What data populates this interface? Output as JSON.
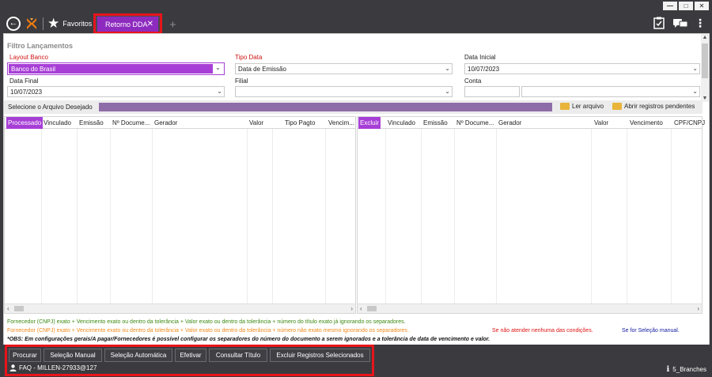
{
  "titlebar": {
    "window_controls": [
      "—",
      "□",
      "✕"
    ],
    "favorites_label": "Favoritos",
    "active_tab": "Retorno DDA",
    "tab_close": "✕",
    "tab_add": "+"
  },
  "filters": {
    "section_title": "Filtro Lançamentos",
    "layout_banco": {
      "label": "Layout Banco",
      "value": "Banco do Brasil"
    },
    "tipo_data": {
      "label": "Tipo Data",
      "value": "Data de Emissão"
    },
    "data_inicial": {
      "label": "Data Inicial",
      "value": "10/07/2023"
    },
    "data_final": {
      "label": "Data Final",
      "value": "10/07/2023"
    },
    "filial": {
      "label": "Filial",
      "value": ""
    },
    "conta": {
      "label": "Conta",
      "value": ""
    }
  },
  "file_selector": {
    "label": "Selecione o Arquivo Desejado",
    "read_file": "Ler arquivo",
    "open_pending": "Abrir registros pendentes"
  },
  "left_grid": {
    "columns": [
      "Processado",
      "Vinculado",
      "Emissão",
      "Nº Documento",
      "Gerador",
      "Valor",
      "Tipo Pagto",
      "Vencim..."
    ],
    "columns_display": [
      "Processado",
      "Vinculado",
      "Emissão",
      "Nº Docume...",
      "Gerador",
      "Valor",
      "Tipo Pagto",
      "Vencim..."
    ]
  },
  "right_grid": {
    "columns_display": [
      "Excluir",
      "Vinculado",
      "Emissão",
      "Nº Docume...",
      "Gerador",
      "Valor",
      "Vencimento",
      "CPF/CNPJ"
    ]
  },
  "legend": {
    "green": "Fornecedor (CNPJ) exato + Vencimento exato ou dentro da tolerância + Valor exato ou dentro da tolerância + número do título exato já ignorando os separadores.",
    "orange": "Fornecedor (CNPJ) exato + Vencimento exato ou dentro da tolerância + Valor exato ou dentro da tolerância + número não exato mesmo ignorando os separadores .",
    "red": "Se não atender nenhuma das condições.",
    "blue": "Se for Seleção manual.",
    "obs": "*OBS: Em configurações gerais/A pagar/Fornecedores é possível configurar os separadores do número do documento a serem ignorados e a tolerância de data de vencimento e valor."
  },
  "actions": {
    "procurar": "Procurar",
    "selecao_manual": "Seleção Manual",
    "selecao_automatica": "Seleção Automática",
    "efetivar": "Efetivar",
    "consultar_titulo": "Consultar Título",
    "excluir_registros": "Excluir Registros Selecionados"
  },
  "status": {
    "user": "FAQ - MILLEN-27933@127",
    "branch": "5_Branches"
  },
  "colors": {
    "accent_purple": "#a73fd6",
    "highlight_red": "#e8141c",
    "dark_bg": "#3b3b3f"
  }
}
